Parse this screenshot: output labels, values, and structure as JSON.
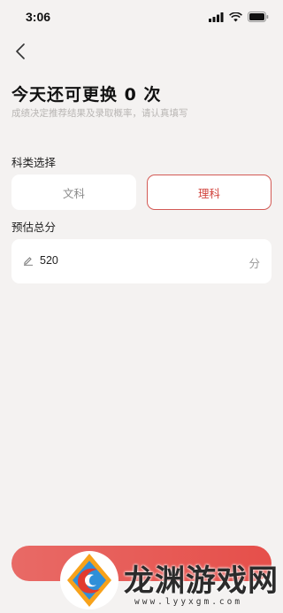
{
  "status_bar": {
    "time": "3:06"
  },
  "header": {
    "title": "今天还可更换 0 次",
    "subtitle": "成绩决定推荐结果及录取概率，请认真填写"
  },
  "subject": {
    "label": "科类选择",
    "options": [
      "文科",
      "理科"
    ],
    "selected": "理科"
  },
  "score": {
    "label": "预估总分",
    "value": "520",
    "unit": "分"
  },
  "colors": {
    "accent": "#e64f4a",
    "background": "#f4f2f1"
  },
  "watermark": {
    "text": "龙渊游戏网",
    "url": "www.lyyxgm.com"
  }
}
